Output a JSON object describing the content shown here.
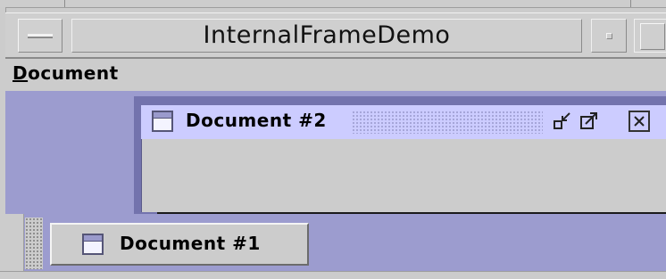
{
  "window": {
    "title": "InternalFrameDemo"
  },
  "menubar": {
    "items": [
      {
        "label_mnemonic": "D",
        "label_rest": "ocument"
      }
    ]
  },
  "internal_frames": [
    {
      "title": "Document #2",
      "state": "active",
      "controls": [
        "iconify-icon",
        "maximize-icon",
        "close-icon"
      ]
    }
  ],
  "iconified_frames": [
    {
      "title": "Document #1"
    }
  ],
  "colors": {
    "desktop": "#9c9ccf",
    "active_frame_border": "#7373ad",
    "active_titlebar": "#ccccff",
    "chrome": "#cccccc"
  }
}
